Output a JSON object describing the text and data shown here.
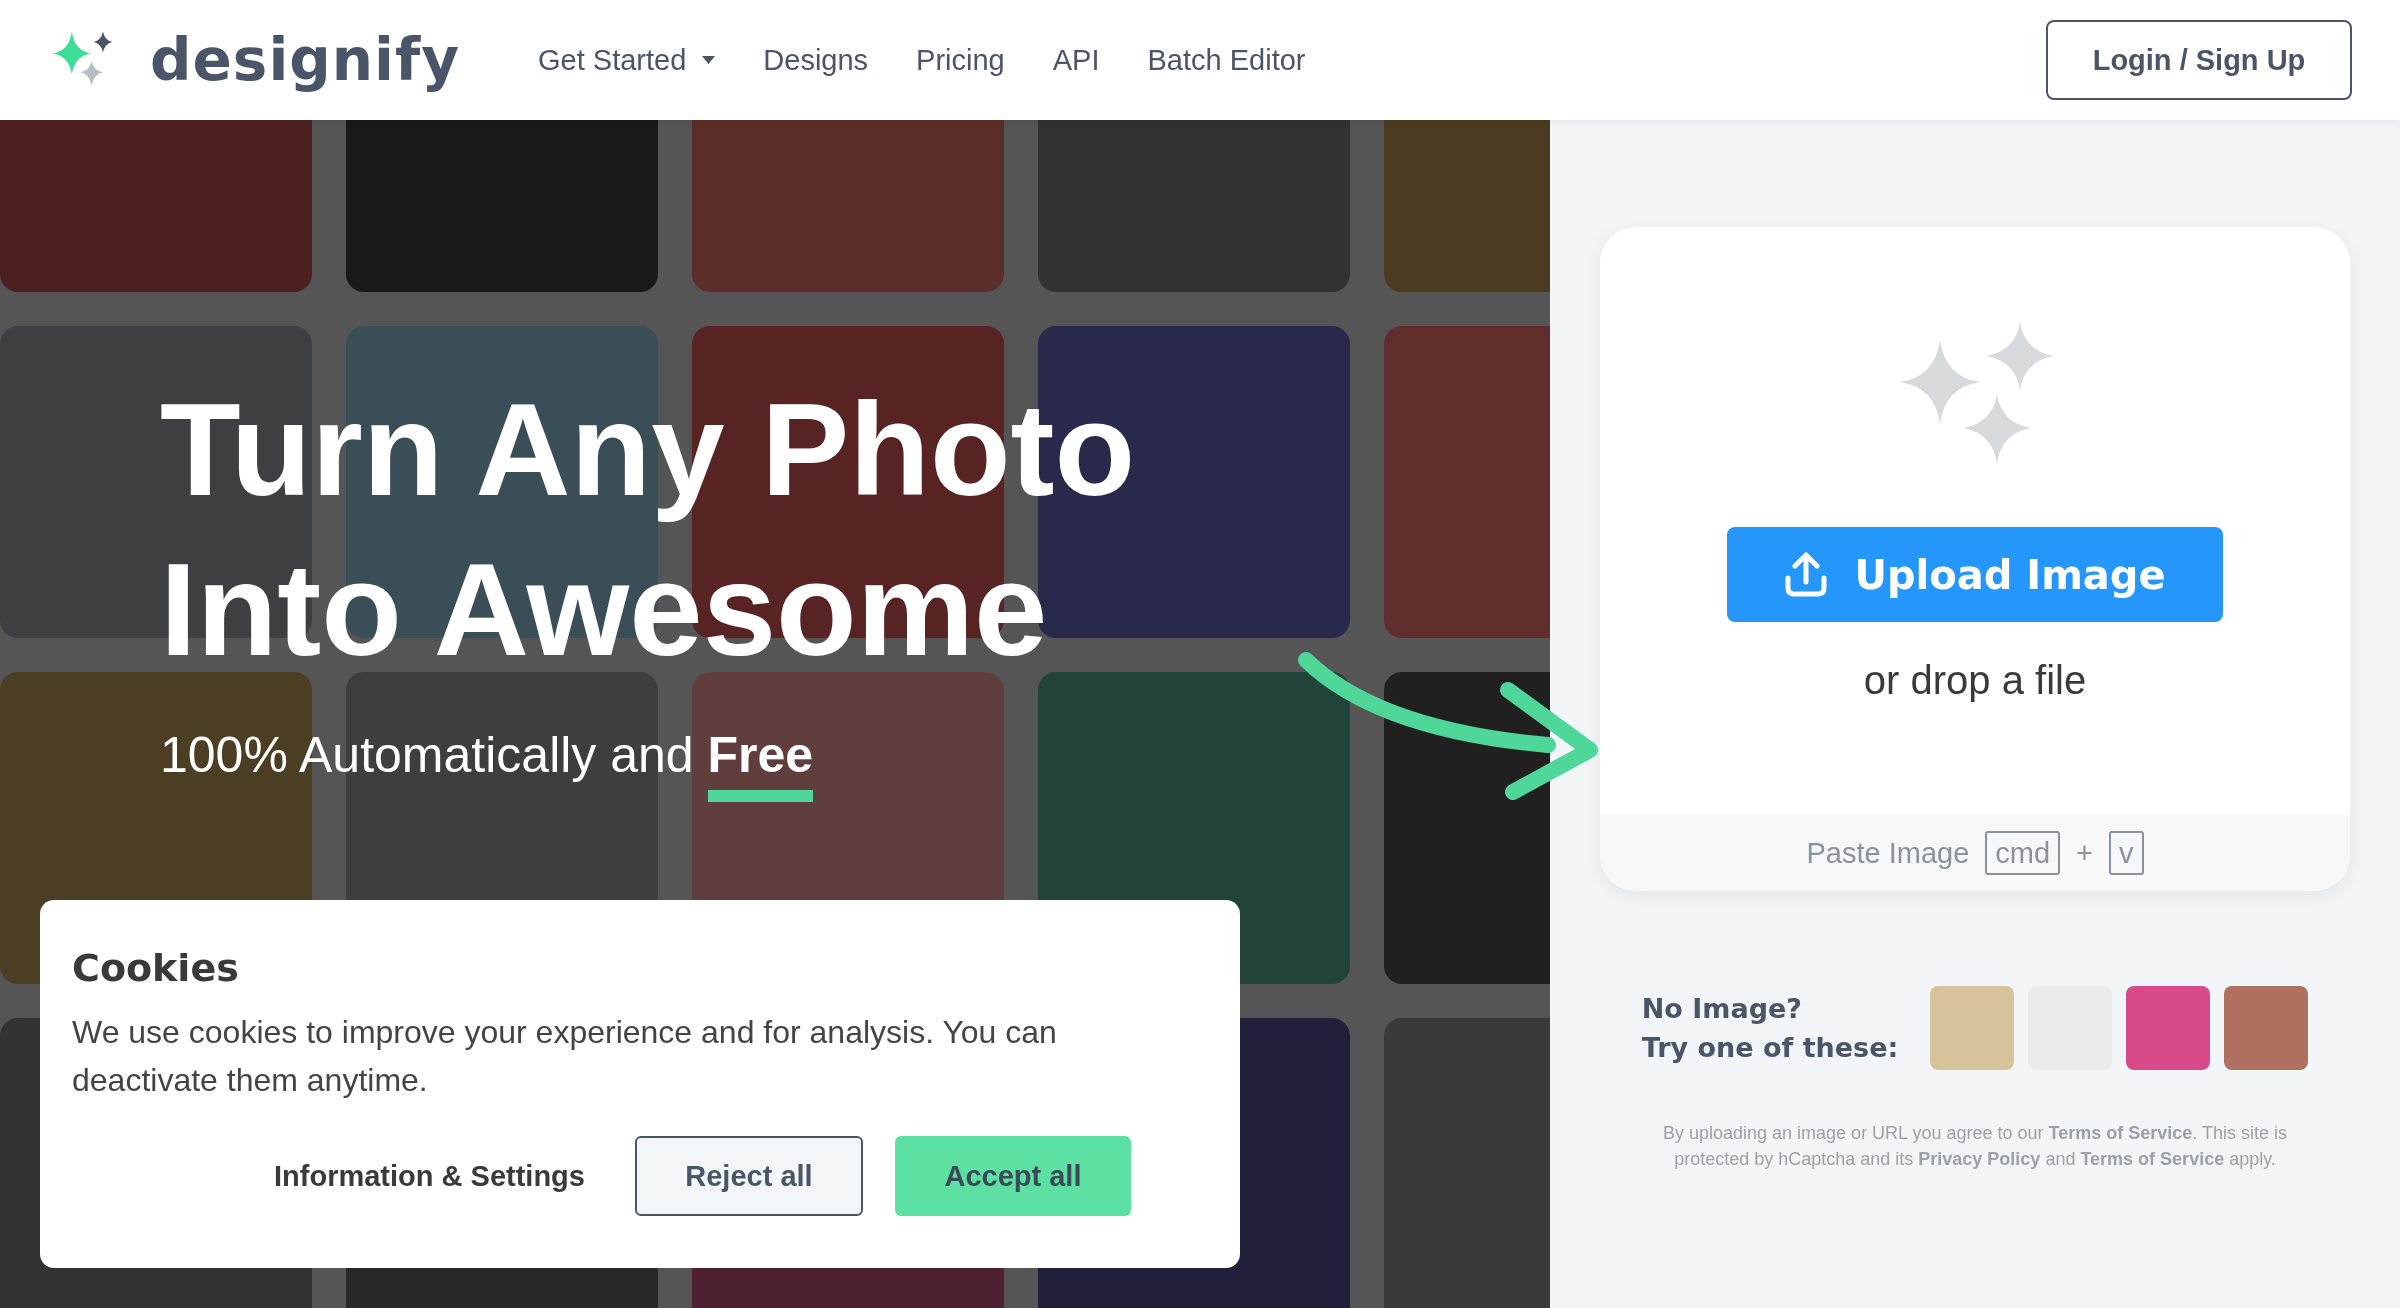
{
  "header": {
    "logo": "designify",
    "nav": [
      {
        "label": "Get Started",
        "dropdown": true
      },
      {
        "label": "Designs",
        "dropdown": false
      },
      {
        "label": "Pricing",
        "dropdown": false
      },
      {
        "label": "API",
        "dropdown": false
      },
      {
        "label": "Batch Editor",
        "dropdown": false
      }
    ],
    "login": "Login / Sign Up"
  },
  "hero": {
    "title_lines": [
      "Turn Any Photo",
      "Into Awesome"
    ],
    "subtitle": "100% Automatically and **Free**"
  },
  "upload": {
    "button": "Upload Image",
    "drop_text": "or drop a file",
    "paste_label": "Paste Image",
    "keys": [
      "cmd",
      "v"
    ],
    "plus": "+"
  },
  "samples": {
    "label_lines": [
      "No Image?",
      "Try one of these:"
    ]
  },
  "legal": "By uploading an image or URL you agree to our **Terms of Service**. This site is protected by hCaptcha and its **Privacy Policy** and **Terms of Service** apply.",
  "cookies": {
    "title": "Cookies",
    "text": "We use cookies to improve your experience and for analysis. You can deactivate them anytime.",
    "buttons": [
      {
        "label": "Information & Settings",
        "kind": "link"
      },
      {
        "label": "Reject all",
        "kind": "outline"
      },
      {
        "label": "Accept all",
        "kind": "primary"
      }
    ]
  }
}
